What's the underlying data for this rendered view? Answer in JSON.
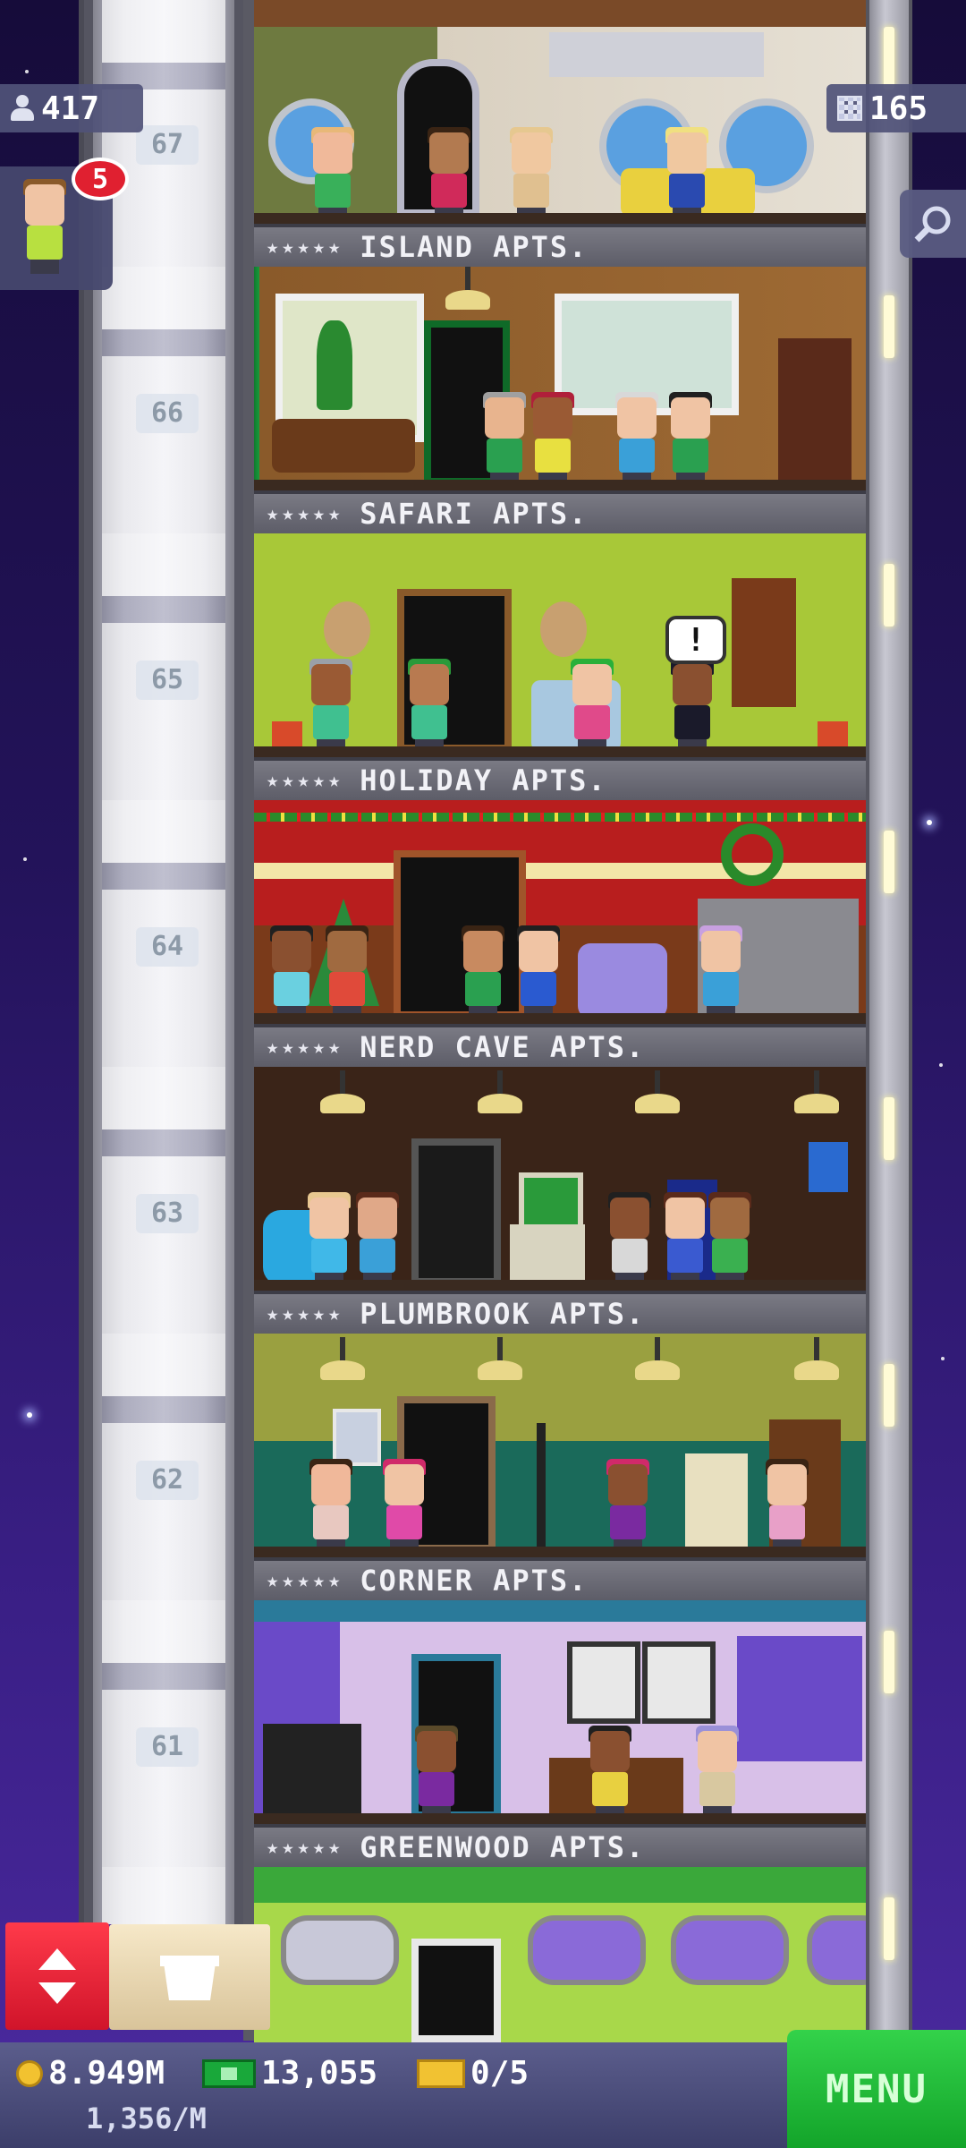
{
  "hud": {
    "population": "417",
    "floors_count": "165",
    "visitor_badge": "5"
  },
  "floors": [
    {
      "number": "67",
      "name": "ISLAND APTS.",
      "stars": "★★★★★"
    },
    {
      "number": "66",
      "name": "SAFARI APTS.",
      "stars": "★★★★★"
    },
    {
      "number": "65",
      "name": "HOLIDAY APTS.",
      "stars": "★★★★★"
    },
    {
      "number": "64",
      "name": "NERD CAVE APTS.",
      "stars": "★★★★★"
    },
    {
      "number": "63",
      "name": "PLUMBROOK APTS.",
      "stars": "★★★★★"
    },
    {
      "number": "62",
      "name": "CORNER APTS.",
      "stars": "★★★★★"
    },
    {
      "number": "61",
      "name": "GREENWOOD APTS.",
      "stars": "★★★★★"
    }
  ],
  "speech_bubble": "!",
  "bottom": {
    "coins": "8.949M",
    "coins_rate": "1,356/M",
    "bux": "13,055",
    "tickets": "0/5",
    "menu_label": "MENU"
  },
  "colors": {
    "menu_green": "#1fb83a",
    "elevator_red": "#e8202f",
    "badge_red": "#e02030"
  }
}
